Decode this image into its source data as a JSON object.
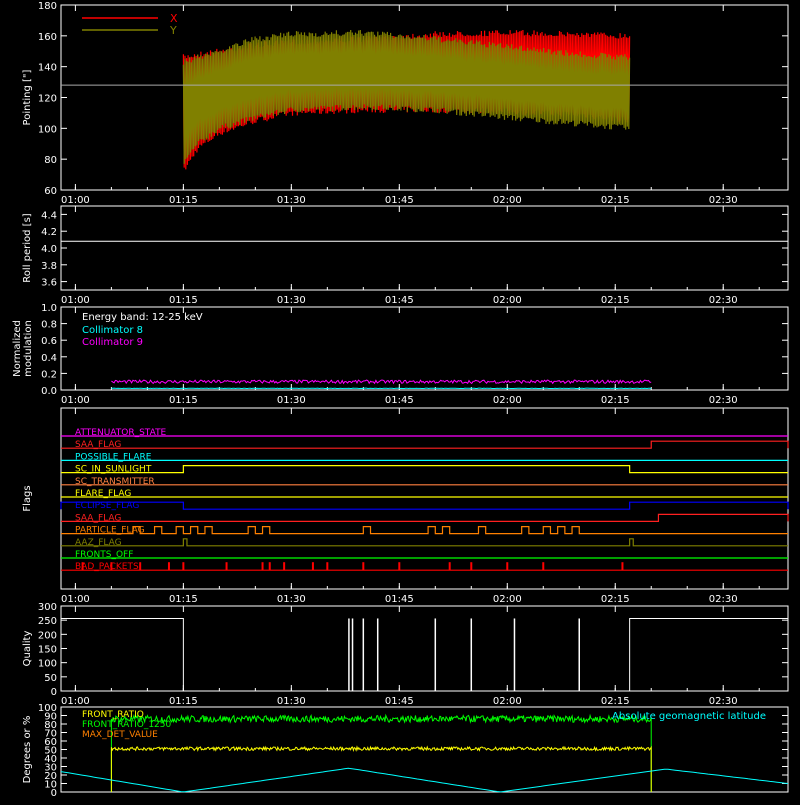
{
  "chart_data": [
    {
      "type": "area",
      "ylabel": "Pointing [\"]",
      "xlim": [
        "00:58",
        "02:39"
      ],
      "ylim": [
        60,
        180
      ],
      "x_ticks": [
        "01:00",
        "01:15",
        "01:30",
        "01:45",
        "02:00",
        "02:15",
        "02:30"
      ],
      "y_ticks": [
        60,
        80,
        100,
        120,
        140,
        160,
        180
      ],
      "reference_line": 128,
      "legend_position": "top-left",
      "series": [
        {
          "name": "X",
          "color": "#ff0000",
          "times": [
            "01:15",
            "01:17",
            "01:20",
            "01:25",
            "01:30",
            "01:40",
            "01:50",
            "02:00",
            "02:10",
            "02:17"
          ],
          "upper": [
            148,
            150,
            152,
            156,
            158,
            160,
            163,
            164,
            163,
            162
          ],
          "lower": [
            70,
            85,
            95,
            103,
            108,
            110,
            110,
            109,
            107,
            103
          ]
        },
        {
          "name": "Y",
          "color": "#808000",
          "times": [
            "01:15",
            "01:17",
            "01:20",
            "01:25",
            "01:30",
            "01:40",
            "01:50",
            "02:00",
            "02:10",
            "02:17"
          ],
          "upper": [
            145,
            148,
            152,
            160,
            163,
            164,
            160,
            155,
            150,
            148
          ],
          "lower": [
            75,
            88,
            98,
            105,
            110,
            112,
            110,
            105,
            101,
            98
          ]
        }
      ]
    },
    {
      "type": "line",
      "ylabel": "Roll period [s]",
      "xlim": [
        "00:58",
        "02:39"
      ],
      "ylim": [
        3.5,
        4.5
      ],
      "x_ticks": [
        "01:00",
        "01:15",
        "01:30",
        "01:45",
        "02:00",
        "02:15",
        "02:30"
      ],
      "y_ticks": [
        "3.6",
        "3.8",
        "4.0",
        "4.2",
        "4.4"
      ],
      "series": [
        {
          "name": "",
          "color": "#ffffff",
          "times": [
            "00:58",
            "02:39"
          ],
          "values": [
            4.08,
            4.08
          ]
        }
      ]
    },
    {
      "type": "line",
      "ylabel": [
        "Normalized",
        "modulation"
      ],
      "xlim": [
        "00:58",
        "02:39"
      ],
      "ylim": [
        0,
        1
      ],
      "x_ticks": [
        "01:00",
        "01:15",
        "01:30",
        "01:45",
        "02:00",
        "02:15",
        "02:30"
      ],
      "y_ticks": [
        "0.0",
        "0.2",
        "0.4",
        "0.6",
        "0.8",
        "1.0"
      ],
      "annotation": "Energy band: 12-25 keV",
      "series": [
        {
          "name": "Collimator 8",
          "color": "#00ffff",
          "times": [
            "01:05",
            "02:20"
          ],
          "values": [
            0.02,
            0.02
          ]
        },
        {
          "name": "Collimator 9",
          "color": "#ff00ff",
          "times": [
            "01:05",
            "02:20"
          ],
          "values": [
            0.1,
            0.1
          ]
        }
      ]
    },
    {
      "type": "line",
      "ylabel": "Flags",
      "xlim": [
        "00:58",
        "02:39"
      ],
      "x_ticks": [
        "01:00",
        "01:15",
        "01:30",
        "01:45",
        "02:00",
        "02:15",
        "02:30"
      ],
      "flags": [
        {
          "name": "ATTENUATOR_STATE",
          "color": "#ff00ff",
          "on": []
        },
        {
          "name": "SAA_FLAG",
          "color": "#ff2020",
          "on": [
            [
              "02:20",
              "02:39"
            ]
          ]
        },
        {
          "name": "POSSIBLE_FLARE",
          "color": "#00ffff",
          "on": []
        },
        {
          "name": "SC_IN_SUNLIGHT",
          "color": "#ffff00",
          "on": [
            [
              "01:15",
              "02:17"
            ]
          ]
        },
        {
          "name": "SC_TRANSMITTER",
          "color": "#ff8040",
          "on": []
        },
        {
          "name": "FLARE_FLAG",
          "color": "#ffff00",
          "on": []
        },
        {
          "name": "ECLIPSE_FLAG",
          "color": "#0000ff",
          "on": [
            [
              "00:58",
              "01:15"
            ],
            [
              "02:17",
              "02:39"
            ]
          ]
        },
        {
          "name": "SAA_FLAG",
          "color": "#ff2020",
          "on": [
            [
              "02:21",
              "02:39"
            ]
          ]
        },
        {
          "name": "PARTICLE_FLAG",
          "color": "#ff8000",
          "on": [
            [
              "01:08",
              "01:09"
            ],
            [
              "01:11",
              "01:12"
            ],
            [
              "01:14",
              "01:15"
            ],
            [
              "01:16",
              "01:17"
            ],
            [
              "01:18",
              "01:19"
            ],
            [
              "01:24",
              "01:25"
            ],
            [
              "01:26",
              "01:27"
            ],
            [
              "01:40",
              "01:41"
            ],
            [
              "01:49",
              "01:50"
            ],
            [
              "01:51",
              "01:52"
            ],
            [
              "01:56",
              "01:57"
            ],
            [
              "02:02",
              "02:03"
            ],
            [
              "02:05",
              "02:06"
            ],
            [
              "02:07",
              "02:08"
            ],
            [
              "02:09",
              "02:10"
            ]
          ]
        },
        {
          "name": "AAZ_FLAG",
          "color": "#808000",
          "on": [
            [
              "01:15",
              "01:15.5"
            ],
            [
              "02:17",
              "02:17.5"
            ]
          ]
        },
        {
          "name": "FRONTS_OFF",
          "color": "#00ff00",
          "on": []
        },
        {
          "name": "BAD_PACKETS",
          "color": "#ff0000",
          "on": []
        }
      ],
      "bad_packet_times": [
        "01:01",
        "01:05",
        "01:09",
        "01:13",
        "01:15",
        "01:21",
        "01:26",
        "01:27",
        "01:29",
        "01:33",
        "01:35",
        "01:40",
        "01:45",
        "01:52",
        "01:55",
        "02:00",
        "02:05",
        "02:16"
      ]
    },
    {
      "type": "line",
      "ylabel": "Quality",
      "xlim": [
        "00:58",
        "02:39"
      ],
      "ylim": [
        0,
        300
      ],
      "x_ticks": [
        "01:00",
        "01:15",
        "01:30",
        "01:45",
        "02:00",
        "02:15",
        "02:30"
      ],
      "y_ticks": [
        0,
        50,
        100,
        150,
        200,
        250,
        300
      ],
      "series": [
        {
          "name": "",
          "color": "#ffffff",
          "segments": [
            [
              "00:58",
              "01:15",
              256
            ],
            [
              "02:17",
              "02:39",
              256
            ]
          ],
          "spikes": [
            "01:38",
            "01:38.5",
            "01:40",
            "01:42",
            "01:50",
            "01:55",
            "02:01",
            "02:10"
          ],
          "spike_value": 256
        }
      ]
    },
    {
      "type": "line",
      "ylabel": "Degrees or %",
      "xlim": [
        "00:58",
        "02:39"
      ],
      "ylim": [
        0,
        100
      ],
      "y_ticks": [
        0,
        10,
        20,
        30,
        40,
        50,
        60,
        70,
        80,
        90,
        100
      ],
      "legend_position": "top-left",
      "series": [
        {
          "name": "FRONT_RATIO",
          "color": "#ffff00",
          "times": [
            "01:05",
            "02:20"
          ],
          "values": [
            51,
            51
          ]
        },
        {
          "name": "FRONT_RATIO_1250",
          "color": "#00ff00",
          "times": [
            "01:05",
            "02:20"
          ],
          "values": [
            86,
            86
          ]
        },
        {
          "name": "MAX_DET_VALUE",
          "color": "#ff8000",
          "times": [],
          "values": []
        },
        {
          "name": "Absolute geomagnetic latitude",
          "color": "#00ffff",
          "times": [
            "00:58",
            "01:15",
            "01:38",
            "01:59",
            "02:22",
            "02:39"
          ],
          "values": [
            24,
            0,
            28,
            0,
            27,
            10
          ]
        }
      ]
    }
  ]
}
